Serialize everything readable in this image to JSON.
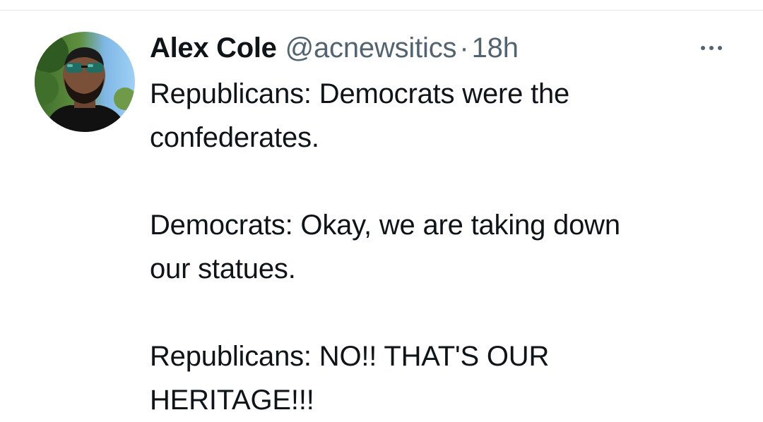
{
  "tweet": {
    "author": {
      "display_name": "Alex Cole",
      "handle": "@acnewsitics"
    },
    "separator": "·",
    "timestamp": "18h",
    "more_icon": "more-horizontal-icon",
    "lines": [
      "Republicans: Democrats were the",
      "confederates.",
      "",
      "Democrats: Okay, we are taking down",
      "our statues.",
      "",
      "Republicans: NO!! THAT'S OUR",
      "HERITAGE!!!"
    ]
  },
  "colors": {
    "text_primary": "#0f1419",
    "text_secondary": "#536471",
    "divider": "#e6e9eb"
  }
}
